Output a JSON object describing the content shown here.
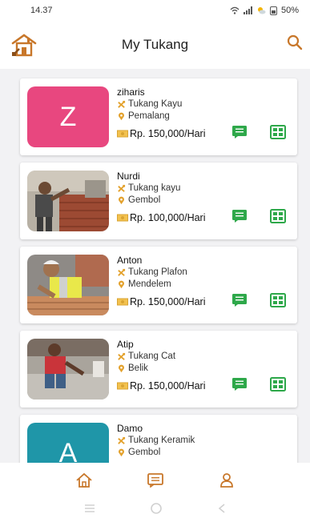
{
  "status_bar": {
    "time": "14.37",
    "battery": "50%"
  },
  "header": {
    "title": "My Tukang"
  },
  "colors": {
    "accent": "#c8772a",
    "green": "#2ea84a",
    "pink": "#e8477f",
    "teal": "#1f96a8"
  },
  "workers": [
    {
      "name": "ziharis",
      "avatar_letter": "Z",
      "avatar_color": "#e8477f",
      "job": "Tukang Kayu",
      "location": "Pemalang",
      "price": "Rp. 150,000/Hari"
    },
    {
      "name": "Nurdi",
      "avatar_letter": "",
      "avatar_color": "",
      "job": "Tukang kayu",
      "location": "Gembol",
      "price": "Rp. 100,000/Hari"
    },
    {
      "name": "Anton",
      "avatar_letter": "",
      "avatar_color": "",
      "job": "Tukang Plafon",
      "location": "Mendelem",
      "price": "Rp. 150,000/Hari"
    },
    {
      "name": "Atip",
      "avatar_letter": "",
      "avatar_color": "",
      "job": "Tukang Cat",
      "location": "Belik",
      "price": "Rp. 150,000/Hari"
    },
    {
      "name": "Damo",
      "avatar_letter": "A",
      "avatar_color": "#1f96a8",
      "job": "Tukang Keramik",
      "location": "Gembol",
      "price": ""
    }
  ],
  "bottom_nav": [
    "home-icon",
    "chat-icon",
    "profile-icon"
  ]
}
